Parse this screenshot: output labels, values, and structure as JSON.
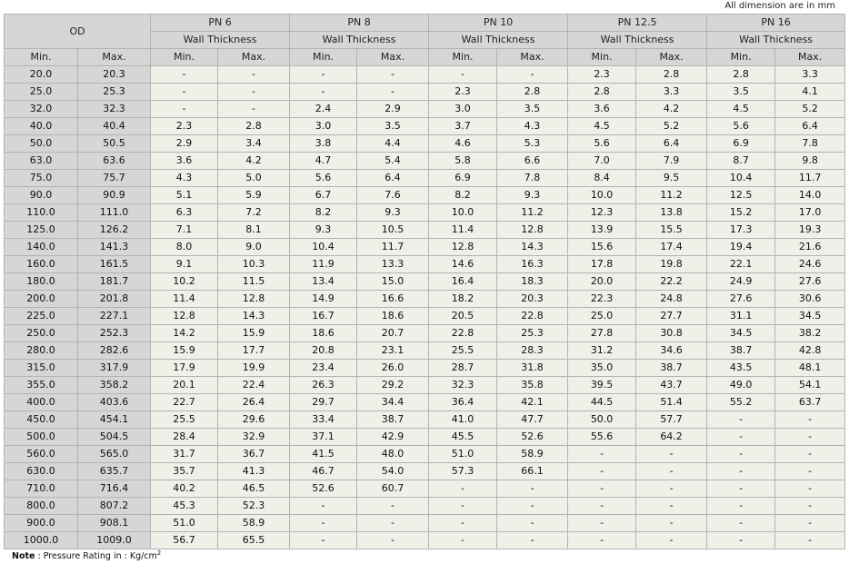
{
  "header_note": "All dimension are in mm",
  "od_label": "OD",
  "sub_label": "Wall Thickness",
  "min_label": "Min.",
  "max_label": "Max.",
  "pressure_classes": [
    "PN 6",
    "PN 8",
    "PN 10",
    "PN 12.5",
    "PN 16"
  ],
  "rows": [
    [
      "20.0",
      "20.3",
      "-",
      "-",
      "-",
      "-",
      "-",
      "-",
      "2.3",
      "2.8",
      "2.8",
      "3.3"
    ],
    [
      "25.0",
      "25.3",
      "-",
      "-",
      "-",
      "-",
      "2.3",
      "2.8",
      "2.8",
      "3.3",
      "3.5",
      "4.1"
    ],
    [
      "32.0",
      "32.3",
      "-",
      "-",
      "2.4",
      "2.9",
      "3.0",
      "3.5",
      "3.6",
      "4.2",
      "4.5",
      "5.2"
    ],
    [
      "40.0",
      "40.4",
      "2.3",
      "2.8",
      "3.0",
      "3.5",
      "3.7",
      "4.3",
      "4.5",
      "5.2",
      "5.6",
      "6.4"
    ],
    [
      "50.0",
      "50.5",
      "2.9",
      "3.4",
      "3.8",
      "4.4",
      "4.6",
      "5.3",
      "5.6",
      "6.4",
      "6.9",
      "7.8"
    ],
    [
      "63.0",
      "63.6",
      "3.6",
      "4.2",
      "4.7",
      "5.4",
      "5.8",
      "6.6",
      "7.0",
      "7.9",
      "8.7",
      "9.8"
    ],
    [
      "75.0",
      "75.7",
      "4.3",
      "5.0",
      "5.6",
      "6.4",
      "6.9",
      "7.8",
      "8.4",
      "9.5",
      "10.4",
      "11.7"
    ],
    [
      "90.0",
      "90.9",
      "5.1",
      "5.9",
      "6.7",
      "7.6",
      "8.2",
      "9.3",
      "10.0",
      "11.2",
      "12.5",
      "14.0"
    ],
    [
      "110.0",
      "111.0",
      "6.3",
      "7.2",
      "8.2",
      "9.3",
      "10.0",
      "11.2",
      "12.3",
      "13.8",
      "15.2",
      "17.0"
    ],
    [
      "125.0",
      "126.2",
      "7.1",
      "8.1",
      "9.3",
      "10.5",
      "11.4",
      "12.8",
      "13.9",
      "15.5",
      "17.3",
      "19.3"
    ],
    [
      "140.0",
      "141.3",
      "8.0",
      "9.0",
      "10.4",
      "11.7",
      "12.8",
      "14.3",
      "15.6",
      "17.4",
      "19.4",
      "21.6"
    ],
    [
      "160.0",
      "161.5",
      "9.1",
      "10.3",
      "11.9",
      "13.3",
      "14.6",
      "16.3",
      "17.8",
      "19.8",
      "22.1",
      "24.6"
    ],
    [
      "180.0",
      "181.7",
      "10.2",
      "11.5",
      "13.4",
      "15.0",
      "16.4",
      "18.3",
      "20.0",
      "22.2",
      "24.9",
      "27.6"
    ],
    [
      "200.0",
      "201.8",
      "11.4",
      "12.8",
      "14.9",
      "16.6",
      "18.2",
      "20.3",
      "22.3",
      "24.8",
      "27.6",
      "30.6"
    ],
    [
      "225.0",
      "227.1",
      "12.8",
      "14.3",
      "16.7",
      "18.6",
      "20.5",
      "22.8",
      "25.0",
      "27.7",
      "31.1",
      "34.5"
    ],
    [
      "250.0",
      "252.3",
      "14.2",
      "15.9",
      "18.6",
      "20.7",
      "22.8",
      "25.3",
      "27.8",
      "30.8",
      "34.5",
      "38.2"
    ],
    [
      "280.0",
      "282.6",
      "15.9",
      "17.7",
      "20.8",
      "23.1",
      "25.5",
      "28.3",
      "31.2",
      "34.6",
      "38.7",
      "42.8"
    ],
    [
      "315.0",
      "317.9",
      "17.9",
      "19.9",
      "23.4",
      "26.0",
      "28.7",
      "31.8",
      "35.0",
      "38.7",
      "43.5",
      "48.1"
    ],
    [
      "355.0",
      "358.2",
      "20.1",
      "22.4",
      "26.3",
      "29.2",
      "32.3",
      "35.8",
      "39.5",
      "43.7",
      "49.0",
      "54.1"
    ],
    [
      "400.0",
      "403.6",
      "22.7",
      "26.4",
      "29.7",
      "34.4",
      "36.4",
      "42.1",
      "44.5",
      "51.4",
      "55.2",
      "63.7"
    ],
    [
      "450.0",
      "454.1",
      "25.5",
      "29.6",
      "33.4",
      "38.7",
      "41.0",
      "47.7",
      "50.0",
      "57.7",
      "-",
      "-"
    ],
    [
      "500.0",
      "504.5",
      "28.4",
      "32.9",
      "37.1",
      "42.9",
      "45.5",
      "52.6",
      "55.6",
      "64.2",
      "-",
      "-"
    ],
    [
      "560.0",
      "565.0",
      "31.7",
      "36.7",
      "41.5",
      "48.0",
      "51.0",
      "58.9",
      "-",
      "-",
      "-",
      "-"
    ],
    [
      "630.0",
      "635.7",
      "35.7",
      "41.3",
      "46.7",
      "54.0",
      "57.3",
      "66.1",
      "-",
      "-",
      "-",
      "-"
    ],
    [
      "710.0",
      "716.4",
      "40.2",
      "46.5",
      "52.6",
      "60.7",
      "-",
      "-",
      "-",
      "-",
      "-",
      "-"
    ],
    [
      "800.0",
      "807.2",
      "45.3",
      "52.3",
      "-",
      "-",
      "-",
      "-",
      "-",
      "-",
      "-",
      "-"
    ],
    [
      "900.0",
      "908.1",
      "51.0",
      "58.9",
      "-",
      "-",
      "-",
      "-",
      "-",
      "-",
      "-",
      "-"
    ],
    [
      "1000.0",
      "1009.0",
      "56.7",
      "65.5",
      "-",
      "-",
      "-",
      "-",
      "-",
      "-",
      "-",
      "-"
    ]
  ],
  "footer": {
    "note_label": "Note",
    "note_text": " : Pressure Rating in : Kg/cm",
    "note_sup": "2"
  },
  "colors": {
    "header_bg": "#d6d6d6",
    "od_bg": "#d6d6d6",
    "value_bg": "#f0efe8",
    "border": "#b3b3b3"
  }
}
